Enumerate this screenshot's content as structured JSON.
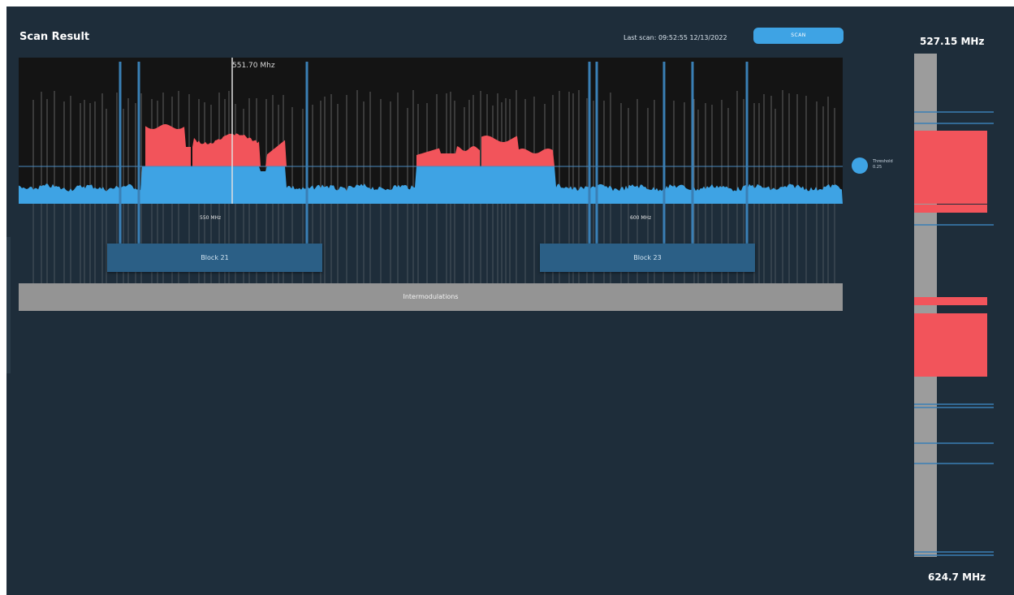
{
  "header": {
    "title": "Scan Result",
    "last_scan_label": "Last scan: 09:52:55 12/13/2022",
    "scan_button_label": "SCAN"
  },
  "spectrum": {
    "cursor_label": "551.70 Mhz",
    "axis_labels": [
      "550 MHz",
      "600 MHz"
    ],
    "threshold_label": "Threshold",
    "threshold_value": "0.25",
    "colors": {
      "background": "#141414",
      "signal": "#3ea3e4",
      "over_threshold": "#f2545b",
      "marker": "#3a7fb5",
      "gridline": "#a0a0a0"
    }
  },
  "blocks": [
    {
      "label": "Block 21"
    },
    {
      "label": "Block 23"
    }
  ],
  "intermodulations_label": "Intermodulations",
  "frequency_range": {
    "top": "527.15 MHz",
    "bottom": "624.7 MHz"
  },
  "colors": {
    "app_background": "#1e2d3a",
    "accent": "#3ea3e4",
    "block_fill": "#2b5f86",
    "intermod_bar": "#949494",
    "alert": "#f2545b"
  }
}
